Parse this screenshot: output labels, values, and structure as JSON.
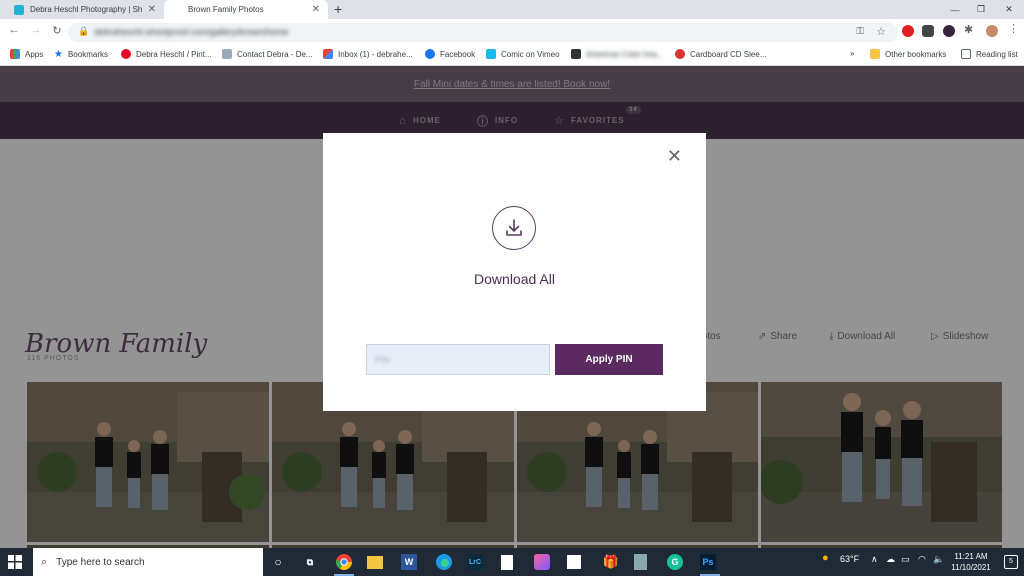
{
  "browser": {
    "tabs": [
      {
        "title": "Debra Heschl Photography | Sho",
        "active": false,
        "favicon_color": "#1fb3d8"
      },
      {
        "title": "Brown Family Photos",
        "active": true
      }
    ],
    "url": "debraheschl.shootproof.com/gallery/brown/home",
    "bookmarks": [
      {
        "label": "Apps",
        "icon": "apps-grid-icon"
      },
      {
        "label": "Bookmarks",
        "icon": "star-icon"
      },
      {
        "label": "Debra Heschl / Pint...",
        "icon": "pinterest-icon"
      },
      {
        "label": "Contact Debra - De...",
        "icon": "site-icon"
      },
      {
        "label": "Inbox (1) - debrahe...",
        "icon": "gmail-icon"
      },
      {
        "label": "Facebook",
        "icon": "facebook-icon"
      },
      {
        "label": "Comic on Vimeo",
        "icon": "vimeo-icon"
      },
      {
        "label": "American Color Ima...",
        "icon": "site-icon"
      },
      {
        "label": "Cardboard CD Slee...",
        "icon": "site-icon"
      },
      {
        "label": "Other bookmarks",
        "icon": "folder-icon"
      },
      {
        "label": "Reading list",
        "icon": "reading-list-icon"
      }
    ],
    "bookmark_overflow": "»"
  },
  "site": {
    "promo_text": "Fall Mini dates & times are listed! Book now!",
    "nav": {
      "home": "HOME",
      "info": "INFO",
      "favorites": "FAVORITES",
      "favorites_count": "34"
    },
    "gallery_title": "Brown Family",
    "gallery_subtitle": "116 PHOTOS",
    "actions": {
      "photos": "Photos",
      "share": "Share",
      "download_all": "Download All",
      "slideshow": "Slideshow"
    }
  },
  "modal": {
    "title": "Download All",
    "pin_placeholder": "PIN",
    "apply_label": "Apply PIN",
    "accent_color": "#5b2a61"
  },
  "taskbar": {
    "search_placeholder": "Type here to search",
    "weather": "63°F",
    "time": "11:21 AM",
    "date": "11/10/2021",
    "notification_count": "5"
  }
}
